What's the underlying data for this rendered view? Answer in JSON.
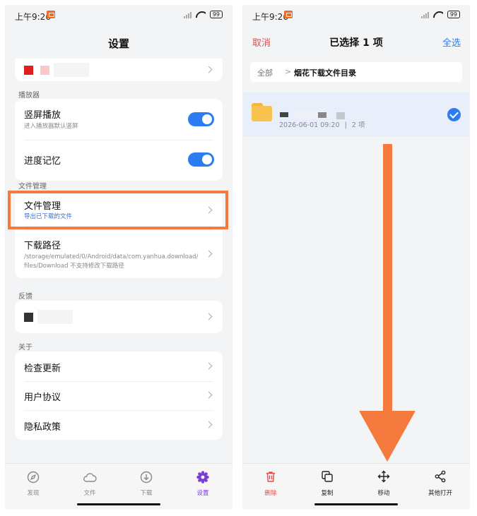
{
  "status_bar": {
    "time": "上午9:26",
    "battery": "99"
  },
  "left": {
    "title": "设置",
    "sections": {
      "player": "播放器",
      "file_mgmt": "文件管理",
      "feedback": "反馈",
      "about": "关于"
    },
    "player": {
      "portrait_label": "竖屏播放",
      "portrait_sub": "进入播放器默认竖屏",
      "progress_label": "进度记忆"
    },
    "file_mgmt": {
      "label": "文件管理",
      "sub": "导出已下载的文件",
      "path_label": "下载路径",
      "path_sub_line1": "/storage/emulated/0/Android/data/com.yanhua.download/",
      "path_sub_line2": "files/Download  不支持修改下载路径"
    },
    "about": {
      "check_update": "检查更新",
      "user_agreement": "用户协议",
      "privacy": "隐私政策"
    },
    "tabs": [
      {
        "label": "发现",
        "icon": "compass-icon"
      },
      {
        "label": "文件",
        "icon": "cloud-icon"
      },
      {
        "label": "下载",
        "icon": "download-icon"
      },
      {
        "label": "设置",
        "icon": "gear-icon"
      }
    ],
    "colors": {
      "highlight": "#f47a3d",
      "toggle_on": "#2b7cf1",
      "active_tab": "#7a3bd6"
    }
  },
  "right": {
    "cancel": "取消",
    "title": "已选择 1 项",
    "select_all": "全选",
    "breadcrumb": {
      "root": "全部",
      "separator": ">",
      "current": "烟花下载文件目录"
    },
    "file": {
      "date": "2026-06-01 09:20",
      "separator": "|",
      "count": "2 项"
    },
    "actions": [
      {
        "label": "删除",
        "icon": "trash-icon"
      },
      {
        "label": "复制",
        "icon": "copy-icon"
      },
      {
        "label": "移动",
        "icon": "move-icon"
      },
      {
        "label": "其他打开",
        "icon": "share-icon"
      }
    ],
    "colors": {
      "cancel": "#e04c4c",
      "select_all": "#2b7cf1",
      "arrow": "#f47a3d"
    }
  }
}
